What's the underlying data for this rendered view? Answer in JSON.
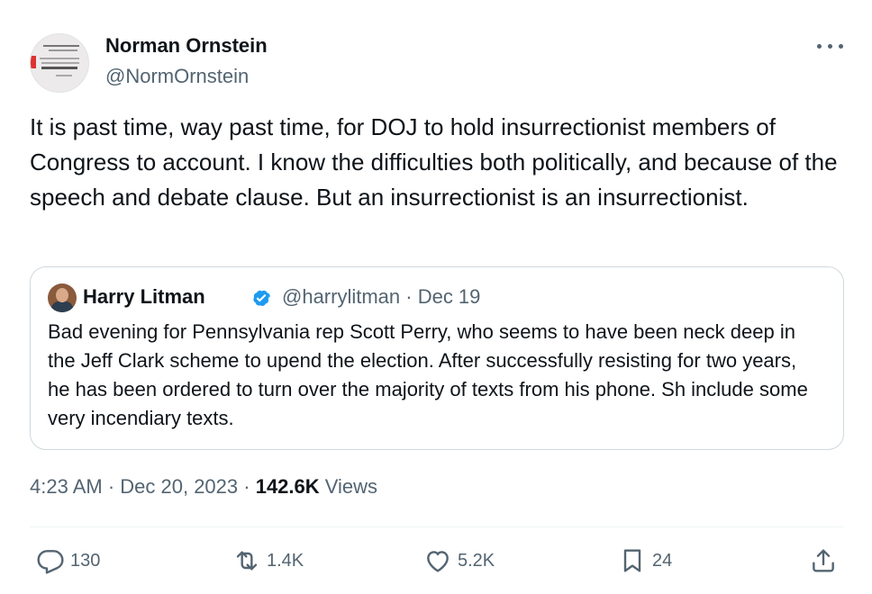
{
  "author": {
    "name": "Norman Ornstein",
    "handle": "@NormOrnstein"
  },
  "tweet": {
    "text": "It is past time, way past time, for DOJ to hold insurrectionist members of Congress to account. I know the difficulties both politically, and because of the speech and debate clause. But an insurrectionist is an insurrectionist."
  },
  "quote": {
    "name": "Harry Litman",
    "meta": "@harrylitman · Dec 19",
    "text": "Bad evening for Pennsylvania rep Scott Perry, who seems to have been neck deep in the Jeff Clark scheme to upend the election. After successfully resisting for two years, he has been ordered to turn over the majority of texts from his phone. Sh include some very incendiary texts."
  },
  "timeinfo": {
    "datetime": "4:23 AM · Dec 20, 2023 · ",
    "views_count": "142.6K",
    "views_label": " Views"
  },
  "actions": {
    "replies": "130",
    "reposts": "1.4K",
    "likes": "5.2K",
    "bookmarks": "24"
  },
  "icons": {
    "more": "more-horizontal-icon",
    "verified": "verified-badge-icon",
    "reply": "reply-icon",
    "repost": "repost-icon",
    "like": "heart-icon",
    "bookmark": "bookmark-icon",
    "share": "share-icon"
  },
  "colors": {
    "text": "#0f1419",
    "secondary": "#536471",
    "verified": "#1d9bf0",
    "border": "#cfd9de"
  }
}
